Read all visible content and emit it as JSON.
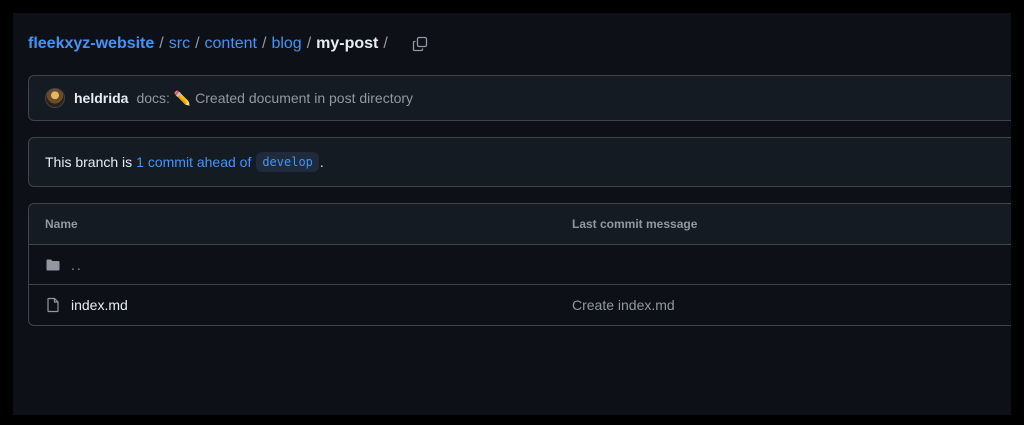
{
  "breadcrumb": {
    "repo": "fleekxyz-website",
    "path": [
      "src",
      "content",
      "blog"
    ],
    "current": "my-post",
    "separator": "/"
  },
  "latest_commit": {
    "author": "heldrida",
    "message": "docs: ✏️ Created document in post directory"
  },
  "branch_status": {
    "prefix": "This branch is",
    "link": "1 commit ahead of",
    "branch": "develop",
    "suffix": "."
  },
  "file_table": {
    "headers": {
      "name": "Name",
      "message": "Last commit message"
    },
    "parent": "..",
    "files": [
      {
        "name": "index.md",
        "message": "Create index.md",
        "icon": "file-icon"
      }
    ]
  },
  "colors": {
    "background": "#0d1117",
    "panel": "#151b23",
    "border": "#3d444d",
    "link": "#4493f8",
    "muted": "#9198a1",
    "text": "#e6edf3"
  }
}
